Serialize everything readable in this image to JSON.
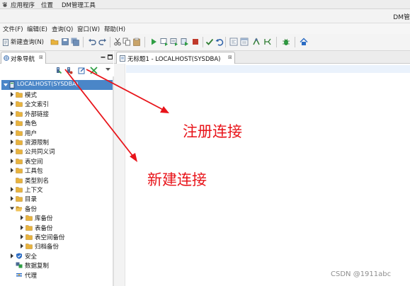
{
  "system_bar": {
    "menus": [
      "应用程序",
      "位置",
      "DM管理工具"
    ]
  },
  "window": {
    "title": "DM管"
  },
  "menubar": {
    "items": [
      "文件(F)",
      "编辑(E)",
      "查询(Q)",
      "窗口(W)",
      "帮助(H)"
    ]
  },
  "toolbar": {
    "new_query_label": "新建查询(N)"
  },
  "navigator": {
    "tab_label": "对象导航",
    "tab_close": "⊠",
    "root": "LOCALHOST(SYSDBA)",
    "items": [
      {
        "label": "模式",
        "depth": 1,
        "arrow": "right",
        "icon": "folder"
      },
      {
        "label": "全文索引",
        "depth": 1,
        "arrow": "right",
        "icon": "folder"
      },
      {
        "label": "外部链接",
        "depth": 1,
        "arrow": "right",
        "icon": "folder"
      },
      {
        "label": "角色",
        "depth": 1,
        "arrow": "right",
        "icon": "folder"
      },
      {
        "label": "用户",
        "depth": 1,
        "arrow": "right",
        "icon": "folder"
      },
      {
        "label": "资源限制",
        "depth": 1,
        "arrow": "right",
        "icon": "folder"
      },
      {
        "label": "公共同义词",
        "depth": 1,
        "arrow": "right",
        "icon": "folder"
      },
      {
        "label": "表空间",
        "depth": 1,
        "arrow": "right",
        "icon": "folder"
      },
      {
        "label": "工具包",
        "depth": 1,
        "arrow": "right",
        "icon": "folder"
      },
      {
        "label": "类型别名",
        "depth": 1,
        "arrow": "none",
        "icon": "folder"
      },
      {
        "label": "上下文",
        "depth": 1,
        "arrow": "right",
        "icon": "folder"
      },
      {
        "label": "目录",
        "depth": 1,
        "arrow": "right",
        "icon": "folder"
      },
      {
        "label": "备份",
        "depth": 1,
        "arrow": "down",
        "icon": "folder-open"
      },
      {
        "label": "库备份",
        "depth": 2,
        "arrow": "right",
        "icon": "folder"
      },
      {
        "label": "表备份",
        "depth": 2,
        "arrow": "right",
        "icon": "folder"
      },
      {
        "label": "表空间备份",
        "depth": 2,
        "arrow": "right",
        "icon": "folder"
      },
      {
        "label": "归档备份",
        "depth": 2,
        "arrow": "right",
        "icon": "folder"
      },
      {
        "label": "安全",
        "depth": 1,
        "arrow": "right",
        "icon": "shield"
      },
      {
        "label": "数据复制",
        "depth": 1,
        "arrow": "none",
        "icon": "replicate"
      },
      {
        "label": "代理",
        "depth": 1,
        "arrow": "none",
        "icon": "agent"
      }
    ]
  },
  "editor": {
    "tab_label": "无标题1 - LOCALHOST(SYSDBA)",
    "tab_close": "⊠"
  },
  "annotations": {
    "register": "注册连接",
    "new_connection": "新建连接",
    "color": "#e8141a"
  },
  "watermark": "CSDN @1911abc",
  "colors": {
    "selection": "#4a86c8",
    "folder": "#e8b33e",
    "current_line": "#eaf2fc"
  }
}
